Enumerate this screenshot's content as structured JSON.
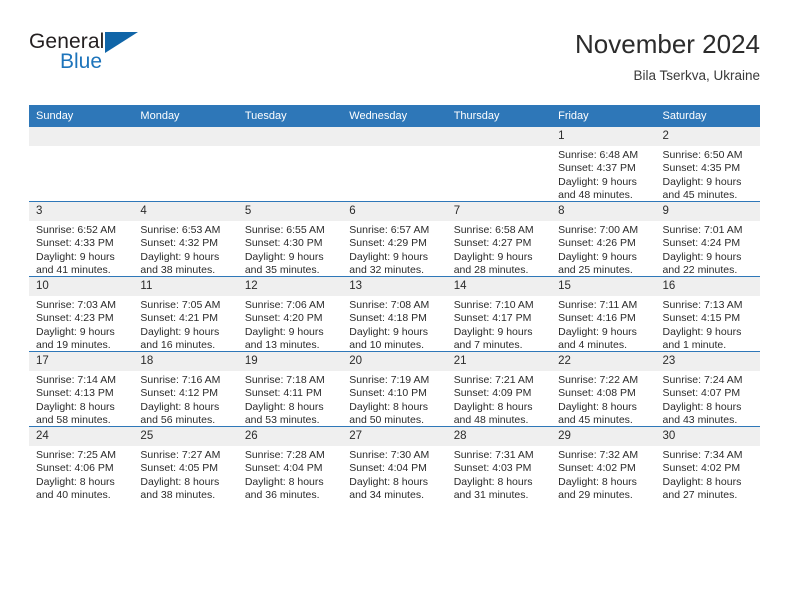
{
  "brand": {
    "word_one": "General",
    "word_two": "Blue",
    "triangle_icon": "triangle-icon"
  },
  "header": {
    "title": "November 2024",
    "subtitle": "Bila Tserkva, Ukraine"
  },
  "colors": {
    "header_blue": "#2e77b8",
    "brand_blue": "#1065a8",
    "date_band_gray": "#efefef",
    "text": "#2b2b2b"
  },
  "weekday_headers": [
    "Sunday",
    "Monday",
    "Tuesday",
    "Wednesday",
    "Thursday",
    "Friday",
    "Saturday"
  ],
  "weeks": [
    [
      {
        "day": "",
        "sunrise": "",
        "sunset": "",
        "daylight_line1": "",
        "daylight_line2": ""
      },
      {
        "day": "",
        "sunrise": "",
        "sunset": "",
        "daylight_line1": "",
        "daylight_line2": ""
      },
      {
        "day": "",
        "sunrise": "",
        "sunset": "",
        "daylight_line1": "",
        "daylight_line2": ""
      },
      {
        "day": "",
        "sunrise": "",
        "sunset": "",
        "daylight_line1": "",
        "daylight_line2": ""
      },
      {
        "day": "",
        "sunrise": "",
        "sunset": "",
        "daylight_line1": "",
        "daylight_line2": ""
      },
      {
        "day": "1",
        "sunrise": "Sunrise: 6:48 AM",
        "sunset": "Sunset: 4:37 PM",
        "daylight_line1": "Daylight: 9 hours",
        "daylight_line2": "and 48 minutes."
      },
      {
        "day": "2",
        "sunrise": "Sunrise: 6:50 AM",
        "sunset": "Sunset: 4:35 PM",
        "daylight_line1": "Daylight: 9 hours",
        "daylight_line2": "and 45 minutes."
      }
    ],
    [
      {
        "day": "3",
        "sunrise": "Sunrise: 6:52 AM",
        "sunset": "Sunset: 4:33 PM",
        "daylight_line1": "Daylight: 9 hours",
        "daylight_line2": "and 41 minutes."
      },
      {
        "day": "4",
        "sunrise": "Sunrise: 6:53 AM",
        "sunset": "Sunset: 4:32 PM",
        "daylight_line1": "Daylight: 9 hours",
        "daylight_line2": "and 38 minutes."
      },
      {
        "day": "5",
        "sunrise": "Sunrise: 6:55 AM",
        "sunset": "Sunset: 4:30 PM",
        "daylight_line1": "Daylight: 9 hours",
        "daylight_line2": "and 35 minutes."
      },
      {
        "day": "6",
        "sunrise": "Sunrise: 6:57 AM",
        "sunset": "Sunset: 4:29 PM",
        "daylight_line1": "Daylight: 9 hours",
        "daylight_line2": "and 32 minutes."
      },
      {
        "day": "7",
        "sunrise": "Sunrise: 6:58 AM",
        "sunset": "Sunset: 4:27 PM",
        "daylight_line1": "Daylight: 9 hours",
        "daylight_line2": "and 28 minutes."
      },
      {
        "day": "8",
        "sunrise": "Sunrise: 7:00 AM",
        "sunset": "Sunset: 4:26 PM",
        "daylight_line1": "Daylight: 9 hours",
        "daylight_line2": "and 25 minutes."
      },
      {
        "day": "9",
        "sunrise": "Sunrise: 7:01 AM",
        "sunset": "Sunset: 4:24 PM",
        "daylight_line1": "Daylight: 9 hours",
        "daylight_line2": "and 22 minutes."
      }
    ],
    [
      {
        "day": "10",
        "sunrise": "Sunrise: 7:03 AM",
        "sunset": "Sunset: 4:23 PM",
        "daylight_line1": "Daylight: 9 hours",
        "daylight_line2": "and 19 minutes."
      },
      {
        "day": "11",
        "sunrise": "Sunrise: 7:05 AM",
        "sunset": "Sunset: 4:21 PM",
        "daylight_line1": "Daylight: 9 hours",
        "daylight_line2": "and 16 minutes."
      },
      {
        "day": "12",
        "sunrise": "Sunrise: 7:06 AM",
        "sunset": "Sunset: 4:20 PM",
        "daylight_line1": "Daylight: 9 hours",
        "daylight_line2": "and 13 minutes."
      },
      {
        "day": "13",
        "sunrise": "Sunrise: 7:08 AM",
        "sunset": "Sunset: 4:18 PM",
        "daylight_line1": "Daylight: 9 hours",
        "daylight_line2": "and 10 minutes."
      },
      {
        "day": "14",
        "sunrise": "Sunrise: 7:10 AM",
        "sunset": "Sunset: 4:17 PM",
        "daylight_line1": "Daylight: 9 hours",
        "daylight_line2": "and 7 minutes."
      },
      {
        "day": "15",
        "sunrise": "Sunrise: 7:11 AM",
        "sunset": "Sunset: 4:16 PM",
        "daylight_line1": "Daylight: 9 hours",
        "daylight_line2": "and 4 minutes."
      },
      {
        "day": "16",
        "sunrise": "Sunrise: 7:13 AM",
        "sunset": "Sunset: 4:15 PM",
        "daylight_line1": "Daylight: 9 hours",
        "daylight_line2": "and 1 minute."
      }
    ],
    [
      {
        "day": "17",
        "sunrise": "Sunrise: 7:14 AM",
        "sunset": "Sunset: 4:13 PM",
        "daylight_line1": "Daylight: 8 hours",
        "daylight_line2": "and 58 minutes."
      },
      {
        "day": "18",
        "sunrise": "Sunrise: 7:16 AM",
        "sunset": "Sunset: 4:12 PM",
        "daylight_line1": "Daylight: 8 hours",
        "daylight_line2": "and 56 minutes."
      },
      {
        "day": "19",
        "sunrise": "Sunrise: 7:18 AM",
        "sunset": "Sunset: 4:11 PM",
        "daylight_line1": "Daylight: 8 hours",
        "daylight_line2": "and 53 minutes."
      },
      {
        "day": "20",
        "sunrise": "Sunrise: 7:19 AM",
        "sunset": "Sunset: 4:10 PM",
        "daylight_line1": "Daylight: 8 hours",
        "daylight_line2": "and 50 minutes."
      },
      {
        "day": "21",
        "sunrise": "Sunrise: 7:21 AM",
        "sunset": "Sunset: 4:09 PM",
        "daylight_line1": "Daylight: 8 hours",
        "daylight_line2": "and 48 minutes."
      },
      {
        "day": "22",
        "sunrise": "Sunrise: 7:22 AM",
        "sunset": "Sunset: 4:08 PM",
        "daylight_line1": "Daylight: 8 hours",
        "daylight_line2": "and 45 minutes."
      },
      {
        "day": "23",
        "sunrise": "Sunrise: 7:24 AM",
        "sunset": "Sunset: 4:07 PM",
        "daylight_line1": "Daylight: 8 hours",
        "daylight_line2": "and 43 minutes."
      }
    ],
    [
      {
        "day": "24",
        "sunrise": "Sunrise: 7:25 AM",
        "sunset": "Sunset: 4:06 PM",
        "daylight_line1": "Daylight: 8 hours",
        "daylight_line2": "and 40 minutes."
      },
      {
        "day": "25",
        "sunrise": "Sunrise: 7:27 AM",
        "sunset": "Sunset: 4:05 PM",
        "daylight_line1": "Daylight: 8 hours",
        "daylight_line2": "and 38 minutes."
      },
      {
        "day": "26",
        "sunrise": "Sunrise: 7:28 AM",
        "sunset": "Sunset: 4:04 PM",
        "daylight_line1": "Daylight: 8 hours",
        "daylight_line2": "and 36 minutes."
      },
      {
        "day": "27",
        "sunrise": "Sunrise: 7:30 AM",
        "sunset": "Sunset: 4:04 PM",
        "daylight_line1": "Daylight: 8 hours",
        "daylight_line2": "and 34 minutes."
      },
      {
        "day": "28",
        "sunrise": "Sunrise: 7:31 AM",
        "sunset": "Sunset: 4:03 PM",
        "daylight_line1": "Daylight: 8 hours",
        "daylight_line2": "and 31 minutes."
      },
      {
        "day": "29",
        "sunrise": "Sunrise: 7:32 AM",
        "sunset": "Sunset: 4:02 PM",
        "daylight_line1": "Daylight: 8 hours",
        "daylight_line2": "and 29 minutes."
      },
      {
        "day": "30",
        "sunrise": "Sunrise: 7:34 AM",
        "sunset": "Sunset: 4:02 PM",
        "daylight_line1": "Daylight: 8 hours",
        "daylight_line2": "and 27 minutes."
      }
    ]
  ]
}
